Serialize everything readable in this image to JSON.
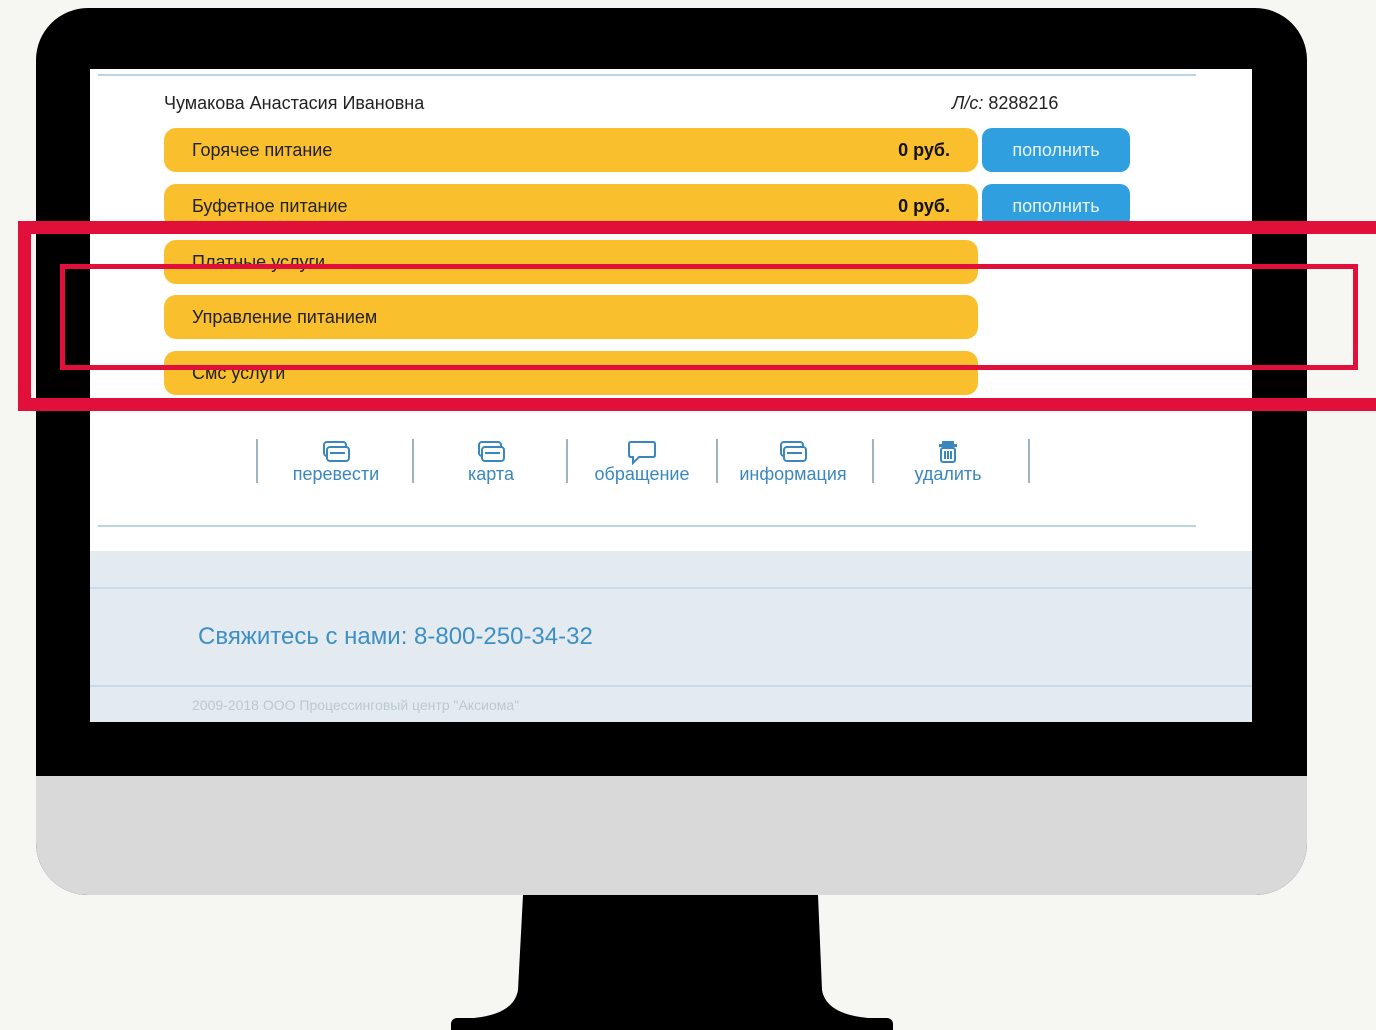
{
  "account": {
    "user_name": "Чумакова Анастасия Ивановна",
    "account_prefix": "Л/с:",
    "account_number": "8288216"
  },
  "services": [
    {
      "label": "Горячее питание",
      "amount": "0 руб.",
      "topup_label": "пополнить"
    },
    {
      "label": "Буфетное питание",
      "amount": "0 руб.",
      "topup_label": "пополнить"
    },
    {
      "label": "Платные услуги"
    },
    {
      "label": "Управление питанием"
    },
    {
      "label": "Смс услуги"
    }
  ],
  "actions": [
    {
      "label": "перевести",
      "icon": "card-icon"
    },
    {
      "label": "карта",
      "icon": "card-icon"
    },
    {
      "label": "обращение",
      "icon": "chat-icon"
    },
    {
      "label": "информация",
      "icon": "card-icon"
    },
    {
      "label": "удалить",
      "icon": "trash-icon"
    }
  ],
  "footer": {
    "contact": "Свяжитесь с нами: 8-800-250-34-32",
    "copyright": "2009-2018 ООО Процессинговый центр \"Аксиома\""
  },
  "colors": {
    "service_row": "#f9bf2c",
    "topup_button": "#2f9fe0",
    "highlight": "#e0103a",
    "link": "#3a86bf"
  }
}
